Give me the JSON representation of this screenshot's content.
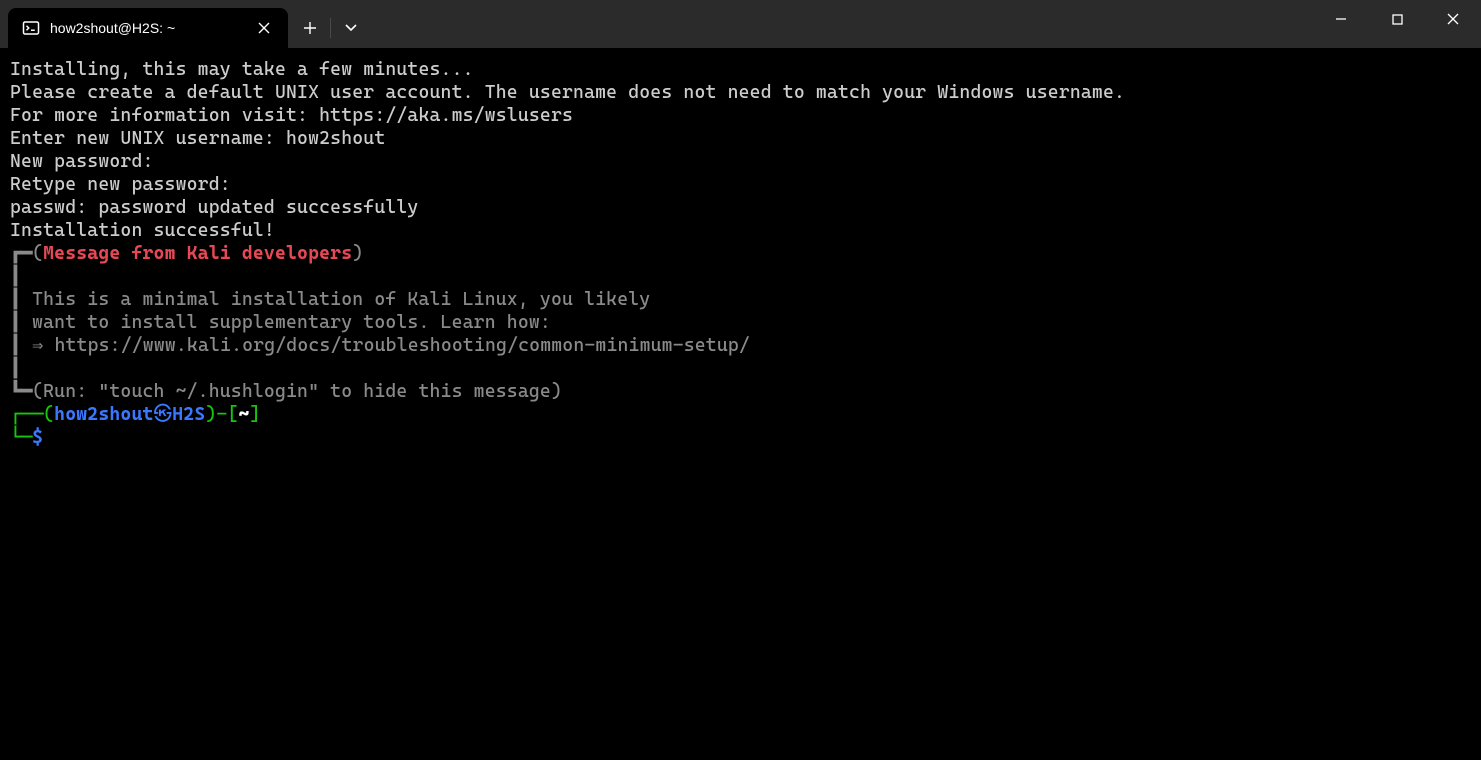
{
  "titlebar": {
    "tab_title": "how2shout@H2S: ~"
  },
  "terminal": {
    "line1": "Installing, this may take a few minutes...",
    "line2": "Please create a default UNIX user account. The username does not need to match your Windows username.",
    "line3": "For more information visit: https://aka.ms/wslusers",
    "line4_prefix": "Enter new UNIX username: ",
    "line4_value": "how2shout",
    "line5": "New password:",
    "line6": "Retype new password:",
    "line7": "passwd: password updated successfully",
    "line8": "Installation successful!",
    "msg_header_open": "┏━(",
    "msg_header_text": "Message from Kali developers",
    "msg_header_close": ")",
    "msg_pipe": "┃",
    "msg_body1": "┃ This is a minimal installation of Kali Linux, you likely",
    "msg_body2": "┃ want to install supplementary tools. Learn how:",
    "msg_body3": "┃ ⇒ https://www.kali.org/docs/troubleshooting/common-minimum-setup/",
    "msg_footer_open": "┗━(",
    "msg_footer_text": "Run: \"touch ~/.hushlogin\" to hide this message",
    "msg_footer_close": ")",
    "prompt_l1_a": "┌──(",
    "prompt_user": "how2shout",
    "prompt_symbol": "㉿",
    "prompt_host": "H2S",
    "prompt_l1_b": ")-[",
    "prompt_path": "~",
    "prompt_l1_c": "]",
    "prompt_l2_a": "└─",
    "prompt_dollar": "$"
  }
}
